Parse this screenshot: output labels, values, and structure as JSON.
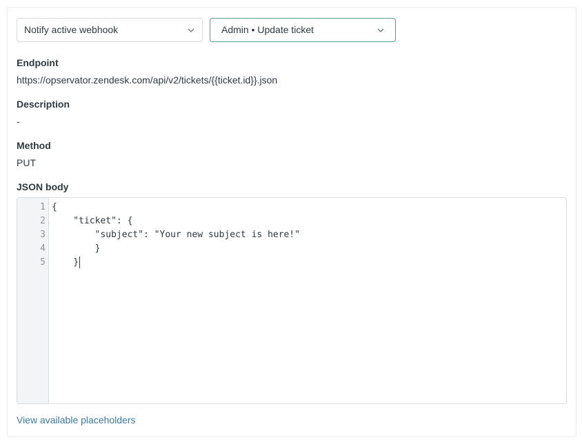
{
  "action": {
    "webhook_select": {
      "value": "Notify active webhook",
      "icon": "chevron-down-icon"
    },
    "webhook_target_select": {
      "value": "Admin • Update ticket",
      "icon": "chevron-down-icon"
    }
  },
  "details": {
    "endpoint_label": "Endpoint",
    "endpoint_value": "https://opservator.zendesk.com/api/v2/tickets/{{ticket.id}}.json",
    "description_label": "Description",
    "description_value": "-",
    "method_label": "Method",
    "method_value": "PUT",
    "json_body_label": "JSON body"
  },
  "editor": {
    "line_numbers": [
      "1",
      "2",
      "3",
      "4",
      "5"
    ],
    "lines": [
      "{",
      "    \"ticket\": {",
      "        \"subject\": \"Your new subject is here!\"",
      "        }",
      "    }"
    ]
  },
  "placeholders_link": "View available placeholders"
}
